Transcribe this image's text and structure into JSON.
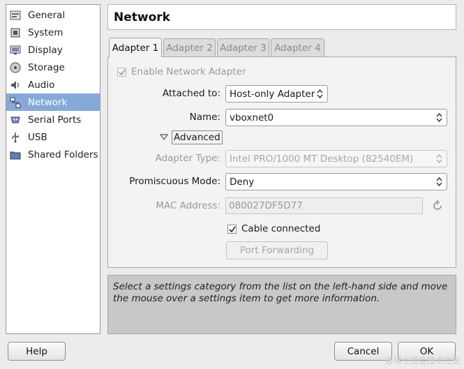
{
  "sidebar": {
    "items": [
      {
        "label": "General",
        "icon": "general-icon"
      },
      {
        "label": "System",
        "icon": "system-icon"
      },
      {
        "label": "Display",
        "icon": "display-icon"
      },
      {
        "label": "Storage",
        "icon": "storage-icon"
      },
      {
        "label": "Audio",
        "icon": "audio-icon"
      },
      {
        "label": "Network",
        "icon": "network-icon",
        "selected": true
      },
      {
        "label": "Serial Ports",
        "icon": "serial-ports-icon"
      },
      {
        "label": "USB",
        "icon": "usb-icon"
      },
      {
        "label": "Shared Folders",
        "icon": "shared-folders-icon"
      }
    ]
  },
  "header": {
    "title": "Network"
  },
  "tabs": [
    {
      "label": "Adapter 1",
      "active": true
    },
    {
      "label": "Adapter 2",
      "active": false
    },
    {
      "label": "Adapter 3",
      "active": false
    },
    {
      "label": "Adapter 4",
      "active": false
    }
  ],
  "adapter": {
    "enable_label": "Enable Network Adapter",
    "enable_checked": true,
    "attached_to_label": "Attached to:",
    "attached_to_value": "Host-only Adapter",
    "name_label": "Name:",
    "name_value": "vboxnet0",
    "advanced_label": "Advanced",
    "adapter_type_label": "Adapter Type:",
    "adapter_type_value": "Intel PRO/1000 MT Desktop (82540EM)",
    "promiscuous_label": "Promiscuous Mode:",
    "promiscuous_value": "Deny",
    "mac_label": "MAC Address:",
    "mac_value": "080027DF5D77",
    "cable_label": "Cable connected",
    "cable_checked": true,
    "port_forwarding_label": "Port Forwarding"
  },
  "info": {
    "text": "Select a settings category from the list on the left-hand side and move the mouse over a settings item to get more information."
  },
  "footer": {
    "help_label": "Help",
    "cancel_label": "Cancel",
    "ok_label": "OK"
  },
  "watermark": "@稀土掘金技术社区",
  "colors": {
    "selection": "#86a9d8",
    "window_bg": "#ececec",
    "info_bg": "#c8c8c8"
  }
}
